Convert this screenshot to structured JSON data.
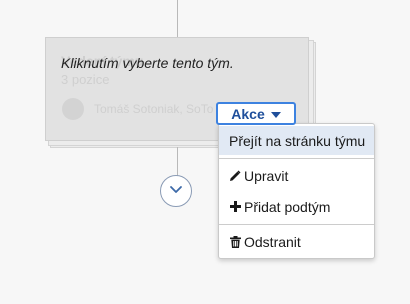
{
  "card": {
    "hint": "Kliknutím vyberte tento tým.",
    "team_name": "Vedení týmu",
    "positions": "3 pozice",
    "members": "Tomáš Sotoniak, SoTo"
  },
  "actions": {
    "button_label": "Akce"
  },
  "menu": {
    "items": [
      {
        "label": "Přejít na stránku týmu",
        "icon": "none"
      },
      {
        "label": "Upravit",
        "icon": "pencil-icon"
      },
      {
        "label": "Přidat podtým",
        "icon": "plus-icon"
      },
      {
        "label": "Odstranit",
        "icon": "trash-icon"
      }
    ]
  },
  "colors": {
    "accent": "#3d82e0",
    "button_text": "#1f4f9b",
    "active_item_bg": "#e1e9f4"
  }
}
